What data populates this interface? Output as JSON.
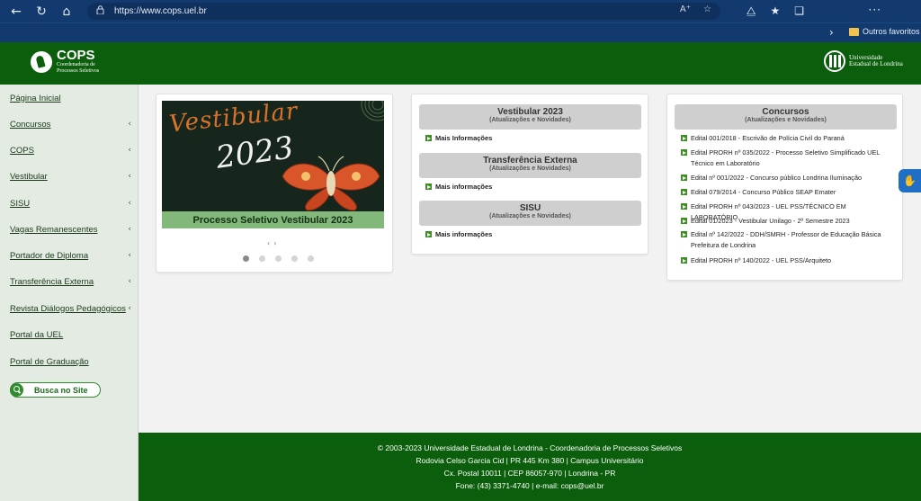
{
  "browser": {
    "url": "https://www.cops.uel.br",
    "favorites_folder": "Outros favoritos"
  },
  "header": {
    "cops_name": "COPS",
    "cops_subtitle_1": "Coordenadoria de",
    "cops_subtitle_2": "Processos Seletivos",
    "uel_line_1": "Universidade",
    "uel_line_2": "Estadual de Londrina"
  },
  "sidebar": {
    "items": [
      {
        "label": "Página Inicial",
        "has_submenu": false
      },
      {
        "label": "Concursos",
        "has_submenu": true
      },
      {
        "label": "COPS",
        "has_submenu": true
      },
      {
        "label": "Vestibular",
        "has_submenu": true
      },
      {
        "label": "SISU",
        "has_submenu": true
      },
      {
        "label": "Vagas Remanescentes",
        "has_submenu": true
      },
      {
        "label": "Portador de Diploma",
        "has_submenu": true
      },
      {
        "label": "Transferência Externa",
        "has_submenu": true
      },
      {
        "label": "Revista Diálogos Pedagógicos",
        "has_submenu": true
      },
      {
        "label": "Portal da UEL",
        "has_submenu": false
      },
      {
        "label": "Portal de Graduação",
        "has_submenu": false
      }
    ],
    "search_label": "Busca no Site"
  },
  "banner": {
    "title_word": "Vestibular",
    "title_year": "2023",
    "caption": "Processo Seletivo Vestibular 2023",
    "slide_count": 5,
    "active_slide": 1
  },
  "middle": {
    "sections": [
      {
        "title": "Vestibular 2023",
        "subtitle": "(Atualizações e Novidades)",
        "link": "Mais Informações"
      },
      {
        "title": "Transferência Externa",
        "subtitle": "(Atualizações e Novidades)",
        "link": "Mais informações"
      },
      {
        "title": "SISU",
        "subtitle": "(Atualizações e Novidades)",
        "link": "Mais informações"
      }
    ]
  },
  "concursos": {
    "title": "Concursos",
    "subtitle": "(Atualizações e Novidades)",
    "items": [
      "Edital 001/2018 - Escrivão de Polícia Civil do Paraná",
      "Edital PRORH nº 035/2022 - Processo Seletivo Simplificado UEL Técnico em Laboratório",
      "Edital nº 001/2022 - Concurso público Londrina Iluminação",
      "Edital 079/2014 - Concurso Público SEAP Emater",
      "Edital PRORH nº 043/2023 - UEL PSS/TÉCNICO EM LABORATÓRIO",
      "Edital 01/2023 - Vestibular Unilago - 2º Semestre 2023",
      "Edital nº 142/2022 - DDH/SMRH - Professor de Educação Básica Prefeitura de Londrina",
      "Edital PRORH nº 140/2022 - UEL PSS/Arquiteto"
    ]
  },
  "footer": {
    "lines": [
      "© 2003-2023 Universidade Estadual de Londrina - Coordenadoria de Processos Seletivos",
      "Rodovia Celso Garcia Cid | PR 445 Km 380 | Campus Universitário",
      "Cx. Postal 10011 | CEP 86057-970 | Londrina - PR",
      "Fone: (43) 3371-4740 | e-mail: cops@uel.br"
    ]
  },
  "colors": {
    "header_green": "#0b5e0b",
    "browser_blue": "#123a6e",
    "sidebar_bg": "#e3ebe3",
    "banner_caption": "#82b97a",
    "accessibility_blue": "#1f6fc7"
  },
  "icons": {
    "back": "back-arrow-icon",
    "refresh": "refresh-icon",
    "home": "home-icon",
    "lock": "lock-icon",
    "read_aloud": "read-aloud-icon",
    "favorite_add": "favorite-add-icon",
    "extensions": "extensions-icon",
    "favorites": "favorites-icon",
    "collections": "collections-icon",
    "more": "more-icon",
    "folder": "folder-icon",
    "accessibility": "sign-language-icon"
  }
}
